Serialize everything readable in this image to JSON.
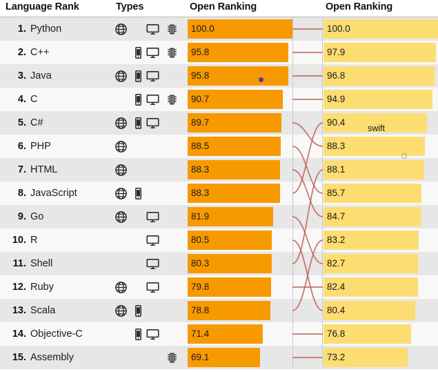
{
  "header": {
    "language_rank": "Language Rank",
    "types": "Types",
    "open_ranking_left": "Open Ranking",
    "open_ranking_right": "Open Ranking"
  },
  "colors": {
    "bar_left": "#f79a00",
    "bar_right": "#fcdd72",
    "row_odd": "#e7e7e7",
    "row_even": "#f8f8f8",
    "connector": "#c0645a",
    "dot_marker": "#5b3a9b",
    "header_rule": "#bdbdbd"
  },
  "annotations": {
    "swift_label": "swift",
    "dot_marker_name": "purple-dot-marker",
    "ring_marker_name": "small-ring-marker"
  },
  "icon_names": {
    "web": "globe-icon",
    "mobile": "mobile-phone-icon",
    "desktop": "desktop-monitor-icon",
    "embedded": "embedded-chip-icon"
  },
  "chart_data": {
    "type": "bar",
    "title": "Language Rank — Open Ranking",
    "xlabel": "",
    "ylabel": "",
    "xlim": [
      0,
      100
    ],
    "grid": false,
    "legend": "none",
    "categories": [
      "Python",
      "C++",
      "Java",
      "C",
      "C#",
      "PHP",
      "HTML",
      "JavaScript",
      "Go",
      "R",
      "Shell",
      "Ruby",
      "Scala",
      "Objective-C",
      "Assembly"
    ],
    "series": [
      {
        "name": "Open Ranking",
        "color": "#f79a00",
        "values": [
          100.0,
          95.8,
          95.8,
          90.7,
          89.7,
          88.5,
          88.3,
          88.3,
          81.9,
          80.5,
          80.3,
          79.8,
          78.8,
          71.4,
          69.1
        ]
      },
      {
        "name": "Open Ranking",
        "color": "#fcdd72",
        "values": [
          100.0,
          97.9,
          96.8,
          94.9,
          90.4,
          88.3,
          88.1,
          85.7,
          84.7,
          83.2,
          82.7,
          82.4,
          80.4,
          76.8,
          73.2
        ]
      }
    ]
  },
  "rows": [
    {
      "rank": "1.",
      "language": "Python",
      "types": [
        "web",
        "desktop",
        "embedded"
      ],
      "left_value": "100.0",
      "left_num": 100.0,
      "right_value": "100.0",
      "right_num": 100.0
    },
    {
      "rank": "2.",
      "language": "C++",
      "types": [
        "mobile",
        "desktop",
        "embedded"
      ],
      "left_value": "95.8",
      "left_num": 95.8,
      "right_value": "97.9",
      "right_num": 97.9
    },
    {
      "rank": "3.",
      "language": "Java",
      "types": [
        "web",
        "mobile",
        "desktop"
      ],
      "left_value": "95.8",
      "left_num": 95.8,
      "right_value": "96.8",
      "right_num": 96.8
    },
    {
      "rank": "4.",
      "language": "C",
      "types": [
        "mobile",
        "desktop",
        "embedded"
      ],
      "left_value": "90.7",
      "left_num": 90.7,
      "right_value": "94.9",
      "right_num": 94.9
    },
    {
      "rank": "5.",
      "language": "C#",
      "types": [
        "web",
        "mobile",
        "desktop"
      ],
      "left_value": "89.7",
      "left_num": 89.7,
      "right_value": "90.4",
      "right_num": 90.4
    },
    {
      "rank": "6.",
      "language": "PHP",
      "types": [
        "web"
      ],
      "left_value": "88.5",
      "left_num": 88.5,
      "right_value": "88.3",
      "right_num": 88.3
    },
    {
      "rank": "7.",
      "language": "HTML",
      "types": [
        "web"
      ],
      "left_value": "88.3",
      "left_num": 88.3,
      "right_value": "88.1",
      "right_num": 88.1
    },
    {
      "rank": "8.",
      "language": "JavaScript",
      "types": [
        "web",
        "mobile"
      ],
      "left_value": "88.3",
      "left_num": 88.3,
      "right_value": "85.7",
      "right_num": 85.7
    },
    {
      "rank": "9.",
      "language": "Go",
      "types": [
        "web",
        "desktop"
      ],
      "left_value": "81.9",
      "left_num": 81.9,
      "right_value": "84.7",
      "right_num": 84.7
    },
    {
      "rank": "10.",
      "language": "R",
      "types": [
        "desktop"
      ],
      "left_value": "80.5",
      "left_num": 80.5,
      "right_value": "83.2",
      "right_num": 83.2
    },
    {
      "rank": "11.",
      "language": "Shell",
      "types": [
        "desktop"
      ],
      "left_value": "80.3",
      "left_num": 80.3,
      "right_value": "82.7",
      "right_num": 82.7
    },
    {
      "rank": "12.",
      "language": "Ruby",
      "types": [
        "web",
        "desktop"
      ],
      "left_value": "79.8",
      "left_num": 79.8,
      "right_value": "82.4",
      "right_num": 82.4
    },
    {
      "rank": "13.",
      "language": "Scala",
      "types": [
        "web",
        "mobile"
      ],
      "left_value": "78.8",
      "left_num": 78.8,
      "right_value": "80.4",
      "right_num": 80.4
    },
    {
      "rank": "14.",
      "language": "Objective-C",
      "types": [
        "mobile",
        "desktop"
      ],
      "left_value": "71.4",
      "left_num": 71.4,
      "right_value": "76.8",
      "right_num": 76.8
    },
    {
      "rank": "15.",
      "language": "Assembly",
      "types": [
        "embedded"
      ],
      "left_value": "69.1",
      "left_num": 69.1,
      "right_value": "73.2",
      "right_num": 73.2
    }
  ],
  "connectors": [
    {
      "from": 1,
      "to": 1
    },
    {
      "from": 2,
      "to": 2
    },
    {
      "from": 3,
      "to": 3
    },
    {
      "from": 4,
      "to": 4
    },
    {
      "from": 5,
      "to": 6
    },
    {
      "from": 6,
      "to": 8
    },
    {
      "from": 7,
      "to": 9
    },
    {
      "from": 8,
      "to": 5
    },
    {
      "from": 9,
      "to": 11
    },
    {
      "from": 10,
      "to": 13
    },
    {
      "from": 11,
      "to": 7
    },
    {
      "from": 12,
      "to": 12
    },
    {
      "from": 13,
      "to": 10
    },
    {
      "from": 14,
      "to": 14
    },
    {
      "from": 15,
      "to": 15
    }
  ]
}
